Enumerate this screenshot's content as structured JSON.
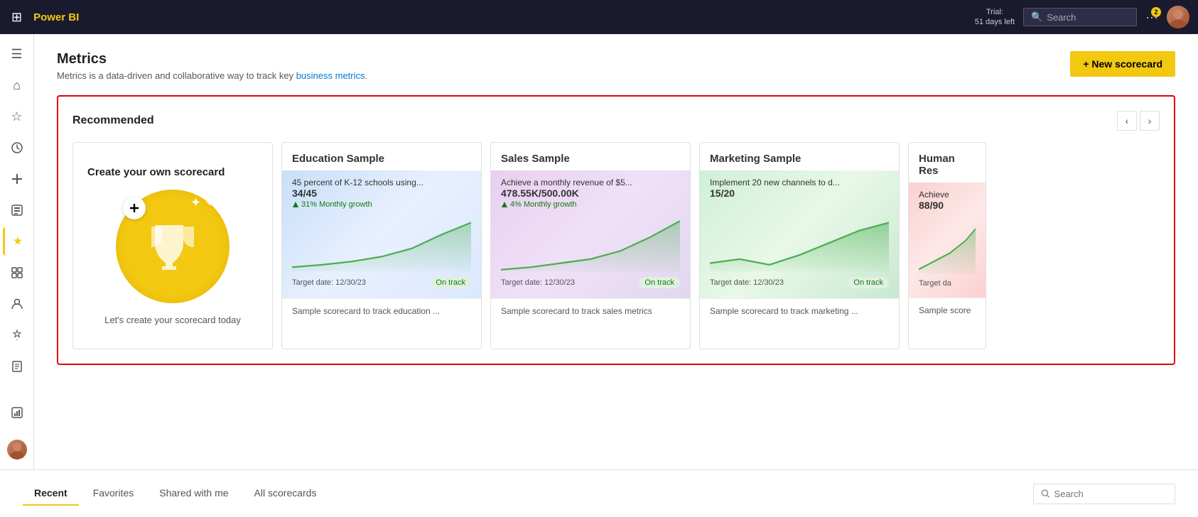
{
  "topnav": {
    "logo": "Power BI",
    "trial_line1": "Trial:",
    "trial_line2": "51 days left",
    "search_placeholder": "Search",
    "notification_count": "2"
  },
  "sidebar": {
    "items": [
      {
        "id": "menu",
        "icon": "☰",
        "label": "Collapse navigation"
      },
      {
        "id": "home",
        "icon": "⌂",
        "label": "Home"
      },
      {
        "id": "favorites",
        "icon": "☆",
        "label": "Favorites"
      },
      {
        "id": "recent",
        "icon": "🕐",
        "label": "Recent"
      },
      {
        "id": "create",
        "icon": "+",
        "label": "Create"
      },
      {
        "id": "datasets",
        "icon": "⬟",
        "label": "Datasets"
      },
      {
        "id": "scorecards",
        "icon": "🏆",
        "label": "Scorecards",
        "active": true
      },
      {
        "id": "workspaces",
        "icon": "⊞",
        "label": "Workspaces"
      },
      {
        "id": "people",
        "icon": "👤",
        "label": "People"
      },
      {
        "id": "apps",
        "icon": "🚀",
        "label": "Apps"
      },
      {
        "id": "learn",
        "icon": "📖",
        "label": "Learn"
      },
      {
        "id": "reports",
        "icon": "⊡",
        "label": "Reports"
      }
    ]
  },
  "page": {
    "title": "Metrics",
    "subtitle": "Metrics is a data-driven and collaborative way to track key business metrics.",
    "subtitle_link": "business metrics"
  },
  "new_scorecard_button": "+ New scorecard",
  "recommended": {
    "title": "Recommended",
    "cards": [
      {
        "id": "create",
        "type": "create",
        "title": "Create your own scorecard",
        "description": "Let's create your scorecard today"
      },
      {
        "id": "education",
        "type": "sample",
        "name": "Education Sample",
        "metric_text": "45 percent of K-12 schools using...",
        "metric_value": "34/45",
        "growth_text": "31% Monthly growth",
        "target_date": "Target date: 12/30/23",
        "status": "On track",
        "description": "Sample scorecard to track education ...",
        "visual_class": "visual-blue"
      },
      {
        "id": "sales",
        "type": "sample",
        "name": "Sales Sample",
        "metric_text": "Achieve a monthly revenue of $5...",
        "metric_value": "478.55K/500.00K",
        "growth_text": "4% Monthly growth",
        "target_date": "Target date: 12/30/23",
        "status": "On track",
        "description": "Sample scorecard to track sales metrics",
        "visual_class": "visual-purple"
      },
      {
        "id": "marketing",
        "type": "sample",
        "name": "Marketing Sample",
        "metric_text": "Implement 20 new channels to d...",
        "metric_value": "15/20",
        "growth_text": "",
        "target_date": "Target date: 12/30/23",
        "status": "On track",
        "description": "Sample scorecard to track marketing ...",
        "visual_class": "visual-green"
      },
      {
        "id": "hr",
        "type": "sample",
        "name": "Human Res",
        "metric_text": "Achieve",
        "metric_value": "88/90",
        "growth_text": "",
        "target_date": "Target da",
        "status": "",
        "description": "Sample score",
        "visual_class": "visual-pink",
        "partial": true
      }
    ]
  },
  "bottom_tabs": {
    "tabs": [
      {
        "id": "recent",
        "label": "Recent",
        "active": true
      },
      {
        "id": "favorites",
        "label": "Favorites",
        "active": false
      },
      {
        "id": "shared",
        "label": "Shared with me",
        "active": false
      },
      {
        "id": "all",
        "label": "All scorecards",
        "active": false
      }
    ],
    "search_placeholder": "Search"
  }
}
